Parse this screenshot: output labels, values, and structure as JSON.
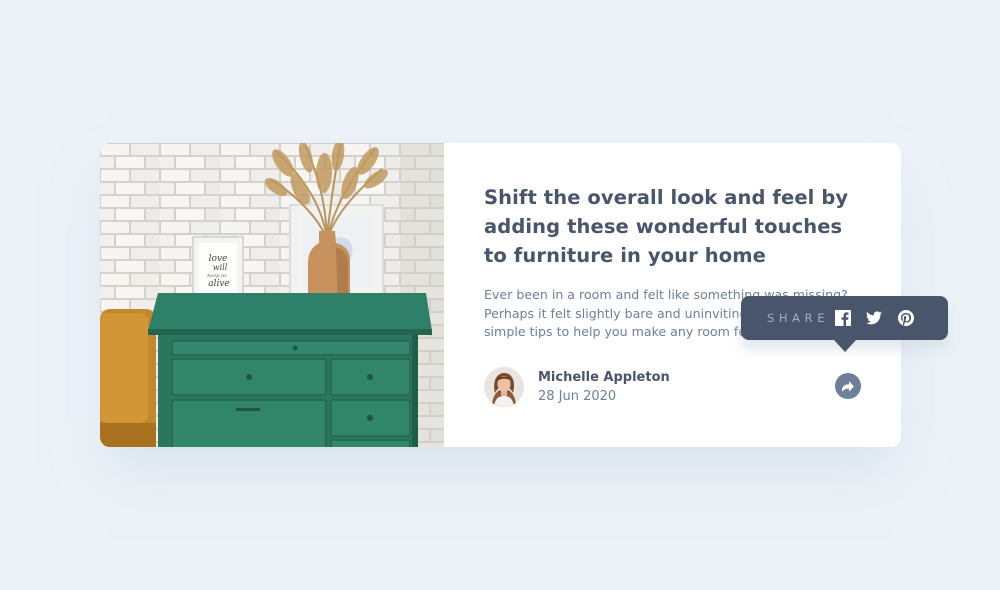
{
  "article": {
    "headline": "Shift the overall look and feel by adding these wonderful touches to furniture in your home",
    "excerpt_lines": [
      "Ever been in a room and felt like something was missing?",
      "Perhaps it felt slightly bare and uninviting. I’ve got some",
      "simple tips to help you make any room feel complete."
    ],
    "image_frame_text": [
      "love",
      "will",
      "keep us",
      "alive"
    ]
  },
  "author": {
    "name": "Michelle Appleton",
    "date": "28 Jun 2020"
  },
  "share": {
    "label": "SHARE",
    "icons": [
      "facebook-icon",
      "twitter-icon",
      "pinterest-icon",
      "share-arrow-icon"
    ]
  },
  "colors": {
    "page_background": "#ecf2f8",
    "card_background": "#ffffff",
    "heading": "#48556a",
    "body_text": "#6e8098",
    "tooltip_background": "#48556a",
    "tooltip_label": "#9eafc2",
    "dresser_green": "#2e7d66"
  }
}
